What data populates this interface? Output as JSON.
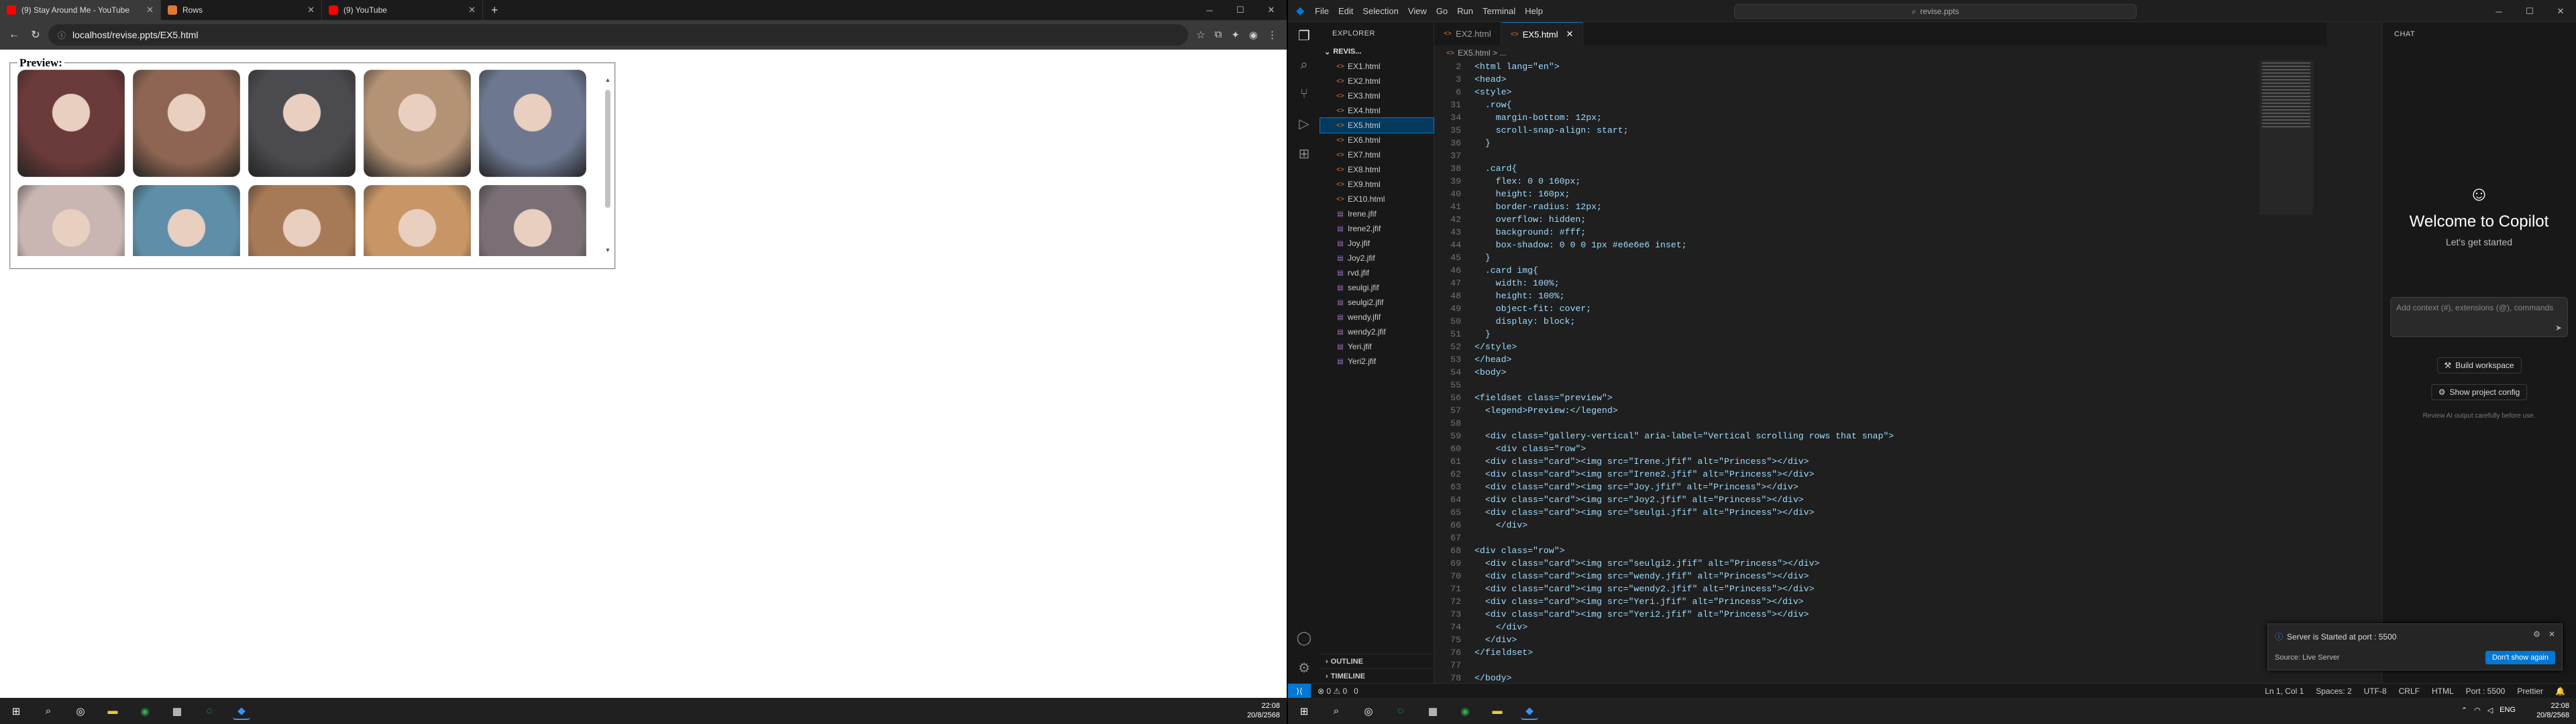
{
  "chrome": {
    "tabs": [
      {
        "title": "(9) Stay Around Me - YouTube",
        "icon": "youtube-icon",
        "color": "#ff0000"
      },
      {
        "title": "Rows",
        "icon": "html-page-icon",
        "color": "#e37933"
      },
      {
        "title": "(9) YouTube",
        "icon": "youtube-icon",
        "color": "#ff0000"
      }
    ],
    "url": "localhost/revise.ppts/EX5.html"
  },
  "preview": {
    "legend": "Preview:",
    "rows": [
      [
        {
          "name": "Irene",
          "color": "#6b3a3a"
        },
        {
          "name": "Irene2",
          "color": "#8d6552"
        },
        {
          "name": "Joy",
          "color": "#4b4a4e"
        },
        {
          "name": "Joy2",
          "color": "#b39275"
        },
        {
          "name": "seulgi",
          "color": "#6d7890"
        }
      ],
      [
        {
          "name": "seulgi2",
          "color": "#c9b6b2"
        },
        {
          "name": "wendy",
          "color": "#5f8ea8"
        },
        {
          "name": "wendy2",
          "color": "#a77a57"
        },
        {
          "name": "Yeri",
          "color": "#c89666"
        },
        {
          "name": "Yeri2",
          "color": "#7a6f75"
        }
      ]
    ]
  },
  "vscode": {
    "menu": [
      "File",
      "Edit",
      "Selection",
      "View",
      "Go",
      "Run",
      "Terminal",
      "Help"
    ],
    "search": "revise.ppts",
    "explorer_title": "EXPLORER",
    "folder": "REVIS...",
    "files": [
      {
        "name": "EX1.html",
        "type": "html"
      },
      {
        "name": "EX2.html",
        "type": "html"
      },
      {
        "name": "EX3.html",
        "type": "html"
      },
      {
        "name": "EX4.html",
        "type": "html"
      },
      {
        "name": "EX5.html",
        "type": "html",
        "selected": true
      },
      {
        "name": "EX6.html",
        "type": "html"
      },
      {
        "name": "EX7.html",
        "type": "html"
      },
      {
        "name": "EX8.html",
        "type": "html"
      },
      {
        "name": "EX9.html",
        "type": "html"
      },
      {
        "name": "EX10.html",
        "type": "html"
      },
      {
        "name": "Irene.jfif",
        "type": "img"
      },
      {
        "name": "Irene2.jfif",
        "type": "img"
      },
      {
        "name": "Joy.jfif",
        "type": "img"
      },
      {
        "name": "Joy2.jfif",
        "type": "img"
      },
      {
        "name": "rvd.jfif",
        "type": "img"
      },
      {
        "name": "seulgi.jfif",
        "type": "img"
      },
      {
        "name": "seulgi2.jfif",
        "type": "img"
      },
      {
        "name": "wendy.jfif",
        "type": "img"
      },
      {
        "name": "wendy2.jfif",
        "type": "img"
      },
      {
        "name": "Yeri.jfif",
        "type": "img"
      },
      {
        "name": "Yeri2.jfif",
        "type": "img"
      }
    ],
    "outline": "OUTLINE",
    "timeline": "TIMELINE",
    "editor_tabs": [
      {
        "name": "EX2.html",
        "active": false
      },
      {
        "name": "EX5.html",
        "active": true
      }
    ],
    "breadcrumb": "EX5.html > ...",
    "code_lines": [
      {
        "n": "2",
        "t": "<html lang=\"en\">"
      },
      {
        "n": "3",
        "t": "<head>"
      },
      {
        "n": "6",
        "t": "<style>"
      },
      {
        "n": "31",
        "t": "  .row{"
      },
      {
        "n": "34",
        "t": "    margin-bottom: 12px;"
      },
      {
        "n": "35",
        "t": "    scroll-snap-align: start;"
      },
      {
        "n": "36",
        "t": "  }"
      },
      {
        "n": "37",
        "t": ""
      },
      {
        "n": "38",
        "t": "  .card{"
      },
      {
        "n": "39",
        "t": "    flex: 0 0 160px;"
      },
      {
        "n": "40",
        "t": "    height: 160px;"
      },
      {
        "n": "41",
        "t": "    border-radius: 12px;"
      },
      {
        "n": "42",
        "t": "    overflow: hidden;"
      },
      {
        "n": "43",
        "t": "    background: #fff;"
      },
      {
        "n": "44",
        "t": "    box-shadow: 0 0 0 1px #e6e6e6 inset;"
      },
      {
        "n": "45",
        "t": "  }"
      },
      {
        "n": "46",
        "t": "  .card img{"
      },
      {
        "n": "47",
        "t": "    width: 100%;"
      },
      {
        "n": "48",
        "t": "    height: 100%;"
      },
      {
        "n": "49",
        "t": "    object-fit: cover;"
      },
      {
        "n": "50",
        "t": "    display: block;"
      },
      {
        "n": "51",
        "t": "  }"
      },
      {
        "n": "52",
        "t": "</style>"
      },
      {
        "n": "53",
        "t": "</head>"
      },
      {
        "n": "54",
        "t": "<body>"
      },
      {
        "n": "55",
        "t": ""
      },
      {
        "n": "56",
        "t": "<fieldset class=\"preview\">"
      },
      {
        "n": "57",
        "t": "  <legend>Preview:</legend>"
      },
      {
        "n": "58",
        "t": ""
      },
      {
        "n": "59",
        "t": "  <div class=\"gallery-vertical\" aria-label=\"Vertical scrolling rows that snap\">"
      },
      {
        "n": "60",
        "t": "    <div class=\"row\">"
      },
      {
        "n": "61",
        "t": "  <div class=\"card\"><img src=\"Irene.jfif\" alt=\"Princess\"></div>"
      },
      {
        "n": "62",
        "t": "  <div class=\"card\"><img src=\"Irene2.jfif\" alt=\"Princess\"></div>"
      },
      {
        "n": "63",
        "t": "  <div class=\"card\"><img src=\"Joy.jfif\" alt=\"Princess\"></div>"
      },
      {
        "n": "64",
        "t": "  <div class=\"card\"><img src=\"Joy2.jfif\" alt=\"Princess\"></div>"
      },
      {
        "n": "65",
        "t": "  <div class=\"card\"><img src=\"seulgi.jfif\" alt=\"Princess\"></div>"
      },
      {
        "n": "66",
        "t": "    </div>"
      },
      {
        "n": "67",
        "t": ""
      },
      {
        "n": "68",
        "t": "<div class=\"row\">"
      },
      {
        "n": "69",
        "t": "  <div class=\"card\"><img src=\"seulgi2.jfif\" alt=\"Princess\"></div>"
      },
      {
        "n": "70",
        "t": "  <div class=\"card\"><img src=\"wendy.jfif\" alt=\"Princess\"></div>"
      },
      {
        "n": "71",
        "t": "  <div class=\"card\"><img src=\"wendy2.jfif\" alt=\"Princess\"></div>"
      },
      {
        "n": "72",
        "t": "  <div class=\"card\"><img src=\"Yeri.jfif\" alt=\"Princess\"></div>"
      },
      {
        "n": "73",
        "t": "  <div class=\"card\"><img src=\"Yeri2.jfif\" alt=\"Princess\"></div>"
      },
      {
        "n": "74",
        "t": "    </div>"
      },
      {
        "n": "75",
        "t": "  </div>"
      },
      {
        "n": "76",
        "t": "</fieldset>"
      },
      {
        "n": "77",
        "t": ""
      },
      {
        "n": "78",
        "t": "</body>"
      }
    ],
    "chat": {
      "title": "CHAT",
      "welcome": "Welcome to Copilot",
      "subtitle": "Let's get started",
      "input_placeholder": "Add context (#), extensions (@), commands",
      "build_workspace": "Build workspace",
      "show_config": "Show project config",
      "note": "Review AI output carefully before use."
    },
    "toast": {
      "message": "Server is Started at port : 5500",
      "source": "Source: Live Server",
      "button": "Don't show again"
    },
    "status": {
      "problems": "⊗ 0 ⚠ 0",
      "ports": "0",
      "position": "Ln 1, Col 1",
      "spaces": "Spaces: 2",
      "encoding": "UTF-8",
      "eol": "CRLF",
      "language": "HTML",
      "port": "Port : 5500",
      "prettier": "Prettier"
    }
  },
  "taskbar": {
    "left_time": "22:08",
    "left_date": "20/8/2568",
    "right_time": "22:08",
    "right_date": "20/8/2568",
    "lang": "ENG"
  }
}
